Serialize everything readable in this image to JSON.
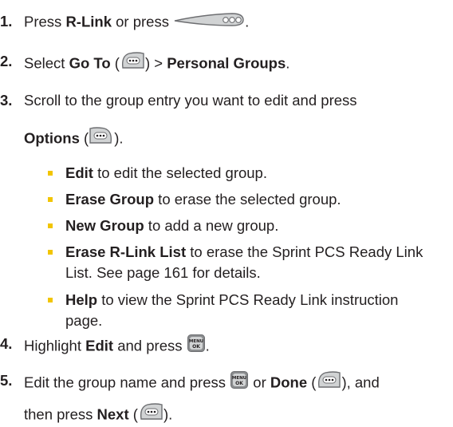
{
  "steps": [
    {
      "num": "1.",
      "pre": "Press ",
      "bold1": "R-Link",
      "mid": " or press ",
      "post": ".",
      "icon": "side-key-icon"
    },
    {
      "num": "2.",
      "pre": "Select ",
      "bold1": "Go To",
      "open": " (",
      "close": ") > ",
      "bold2": "Personal Groups",
      "end": ".",
      "icon": "left-softkey-icon"
    },
    {
      "num": "3.",
      "line1": "Scroll to the group entry you want to edit and press",
      "bold1": "Options",
      "open": " (",
      "close": ").",
      "icon": "right-softkey-icon"
    },
    {
      "num": "4.",
      "pre": "Highlight ",
      "bold1": "Edit",
      "mid": " and press ",
      "end": ".",
      "icon": "menu-ok-icon"
    },
    {
      "num": "5.",
      "pre": "Edit the group name and press ",
      "mid": " or ",
      "bold1": "Done",
      "open": " (",
      "close": "), and",
      "line2_pre": "then press ",
      "bold2": "Next",
      "line2_open": " (",
      "line2_close": ").",
      "icons": [
        "menu-ok-icon",
        "left-softkey-icon",
        "left-softkey-icon"
      ]
    }
  ],
  "options": [
    {
      "label": "Edit",
      "desc": " to edit the selected group."
    },
    {
      "label": "Erase Group",
      "desc": " to erase the selected group."
    },
    {
      "label": "New Group",
      "desc": " to add a new group."
    },
    {
      "label": "Erase R-Link List",
      "desc": " to erase the Sprint PCS Ready Link",
      "desc2": "List. See page 161 for details."
    },
    {
      "label": "Help",
      "desc": " to view the Sprint PCS Ready Link instruction",
      "desc2": "page."
    }
  ],
  "colors": {
    "text": "#231f20",
    "bullet": "#f2c500",
    "key_dark": "#6d6e71",
    "key_light": "#d1d3d4"
  }
}
